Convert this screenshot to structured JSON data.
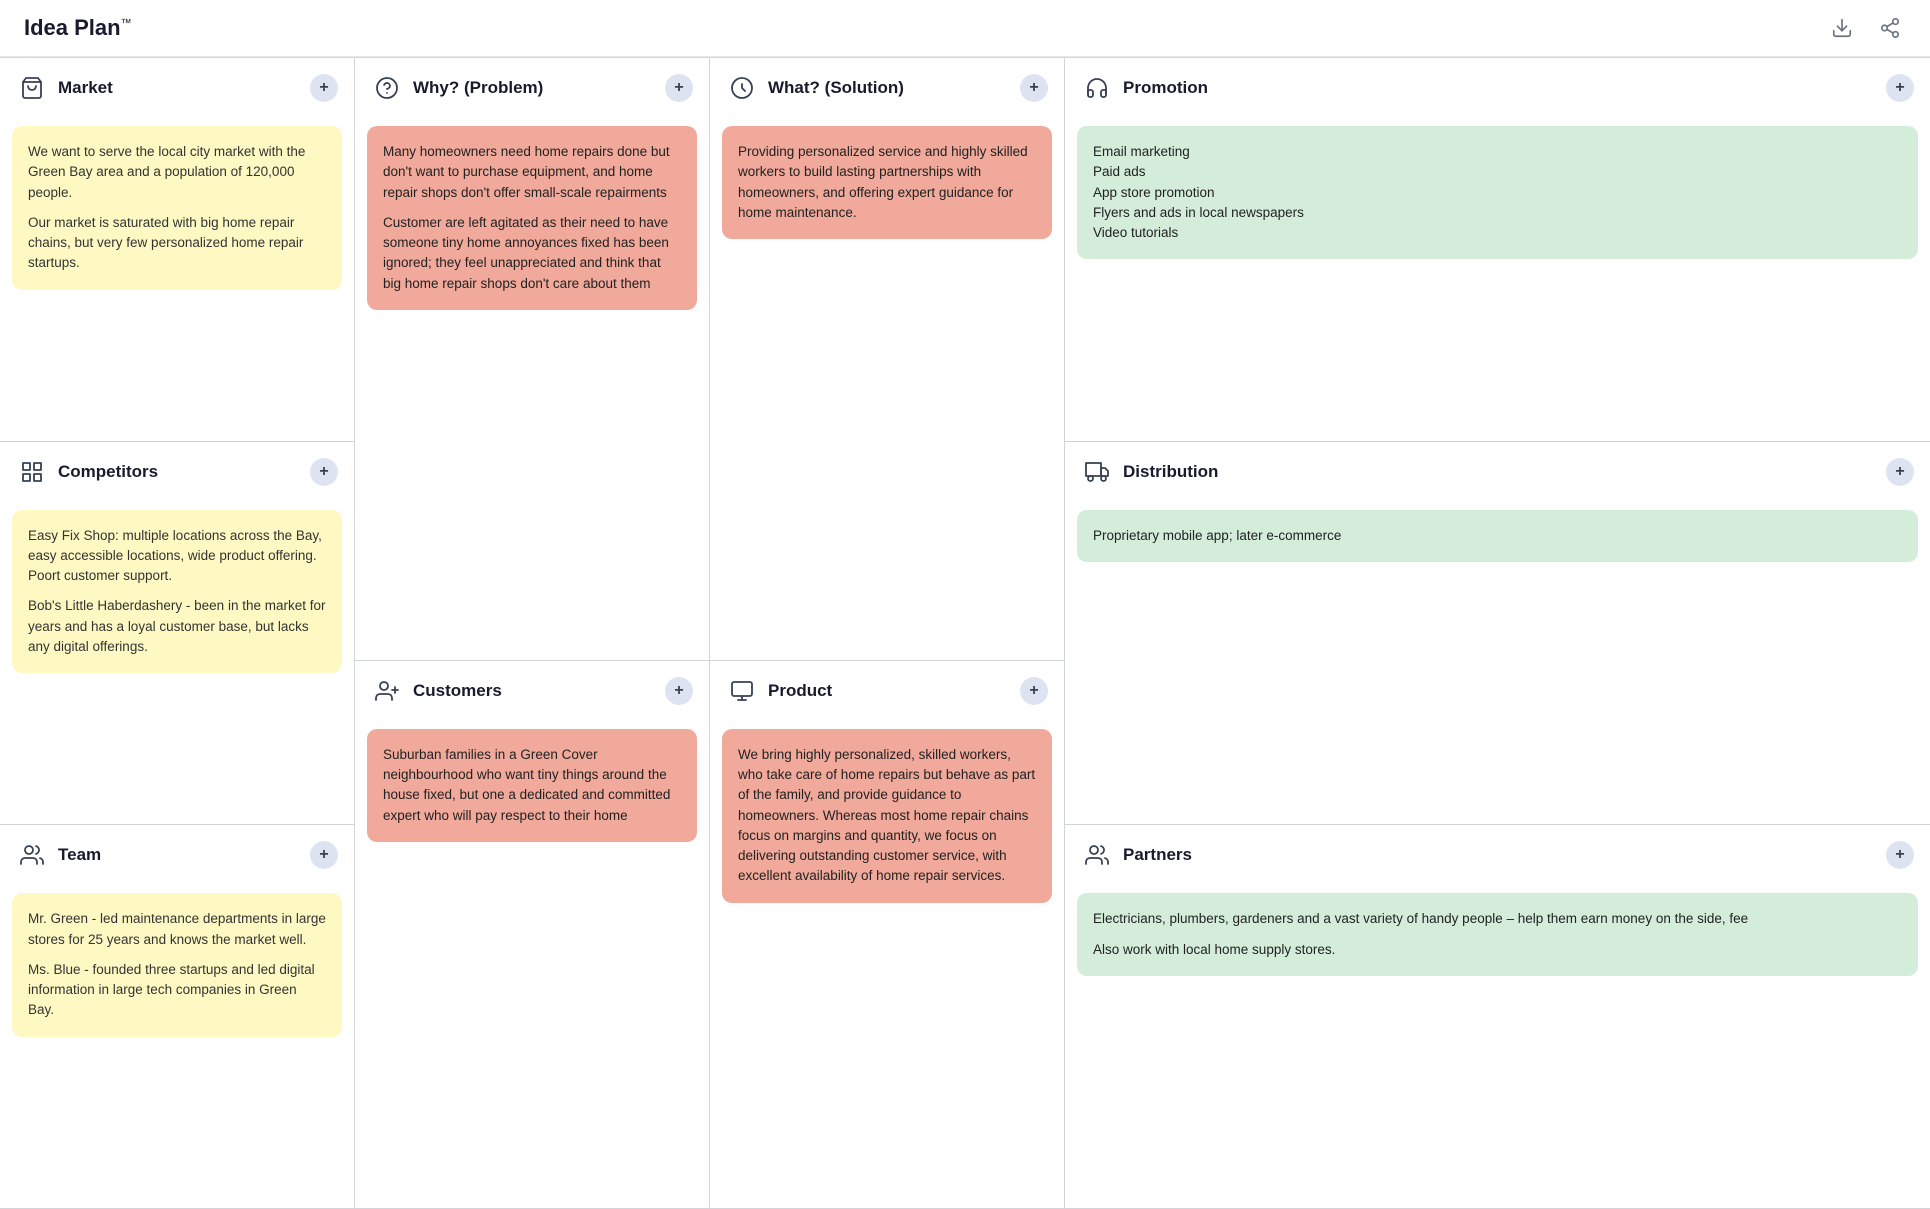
{
  "header": {
    "title": "Idea Plan",
    "trademark": "™"
  },
  "columns": [
    {
      "id": "left",
      "sections": [
        {
          "id": "market",
          "icon": "🛒",
          "title": "Market",
          "cards": [
            {
              "type": "yellow",
              "paragraphs": [
                "We want to serve the local city market with the Green Bay area and a population of 120,000 people.",
                "Our market is saturated with big home repair chains, but very few personalized home repair startups."
              ]
            }
          ]
        },
        {
          "id": "competitors",
          "icon": "🏢",
          "title": "Competitors",
          "cards": [
            {
              "type": "yellow",
              "paragraphs": [
                "Easy Fix Shop: multiple locations across the Bay, easy accessible locations, wide product offering. Poort customer support.",
                "Bob's Little Haberdashery - been in the market for years and has a loyal customer base, but lacks any digital offerings."
              ]
            }
          ]
        },
        {
          "id": "team",
          "icon": "👥",
          "title": "Team",
          "cards": [
            {
              "type": "yellow",
              "paragraphs": [
                "Mr. Green - led maintenance departments in large stores for 25 years and knows the market well.",
                "Ms. Blue - founded three startups and led digital information in large tech companies in Green Bay."
              ]
            }
          ]
        }
      ]
    },
    {
      "id": "middle-left",
      "sections": [
        {
          "id": "why-problem",
          "icon": "❓",
          "title": "Why? (Problem)",
          "cards": [
            {
              "type": "salmon",
              "paragraphs": [
                "Many homeowners need home repairs done but don't want to purchase equipment, and home repair shops don't offer small-scale repairments",
                "Customer are left agitated as their need to have someone tiny home annoyances fixed has been ignored; they feel unappreciated and think that big home repair shops don't care about them"
              ]
            }
          ]
        },
        {
          "id": "customers",
          "icon": "👤",
          "title": "Customers",
          "cards": [
            {
              "type": "salmon",
              "paragraphs": [
                "Suburban families in a Green Cover neighbourhood who want tiny things around the house fixed, but one a dedicated and committed expert who will pay respect to their home"
              ]
            }
          ]
        }
      ]
    },
    {
      "id": "middle-right",
      "sections": [
        {
          "id": "what-solution",
          "icon": "💡",
          "title": "What? (Solution)",
          "cards": [
            {
              "type": "salmon",
              "paragraphs": [
                "Providing personalized service and highly skilled workers to build lasting partnerships with homeowners, and offering expert guidance for home maintenance."
              ]
            }
          ]
        },
        {
          "id": "product",
          "icon": "📦",
          "title": "Product",
          "cards": [
            {
              "type": "salmon",
              "paragraphs": [
                "We bring highly personalized, skilled workers, who take care of home repairs but behave as part of the family, and provide guidance to homeowners. Whereas most home repair chains focus on margins and quantity, we focus on delivering outstanding customer service, with excellent availability of home repair services."
              ]
            }
          ]
        }
      ]
    },
    {
      "id": "right",
      "sections": [
        {
          "id": "promotion",
          "icon": "📢",
          "title": "Promotion",
          "cards": [
            {
              "type": "green",
              "paragraphs": [
                "Email marketing\nPaid ads\nApp store promotion\nFlyers and ads in local newspapers\nVideo tutorials"
              ]
            }
          ]
        },
        {
          "id": "distribution",
          "icon": "🚚",
          "title": "Distribution",
          "cards": [
            {
              "type": "green",
              "paragraphs": [
                "Proprietary mobile app; later e-commerce"
              ]
            }
          ]
        },
        {
          "id": "partners",
          "icon": "🤝",
          "title": "Partners",
          "cards": [
            {
              "type": "green",
              "paragraphs": [
                "Electricians, plumbers, gardeners and a vast variety of handy people – help them earn money on the side, fee",
                "Also work with local home supply stores."
              ]
            }
          ]
        }
      ]
    }
  ]
}
